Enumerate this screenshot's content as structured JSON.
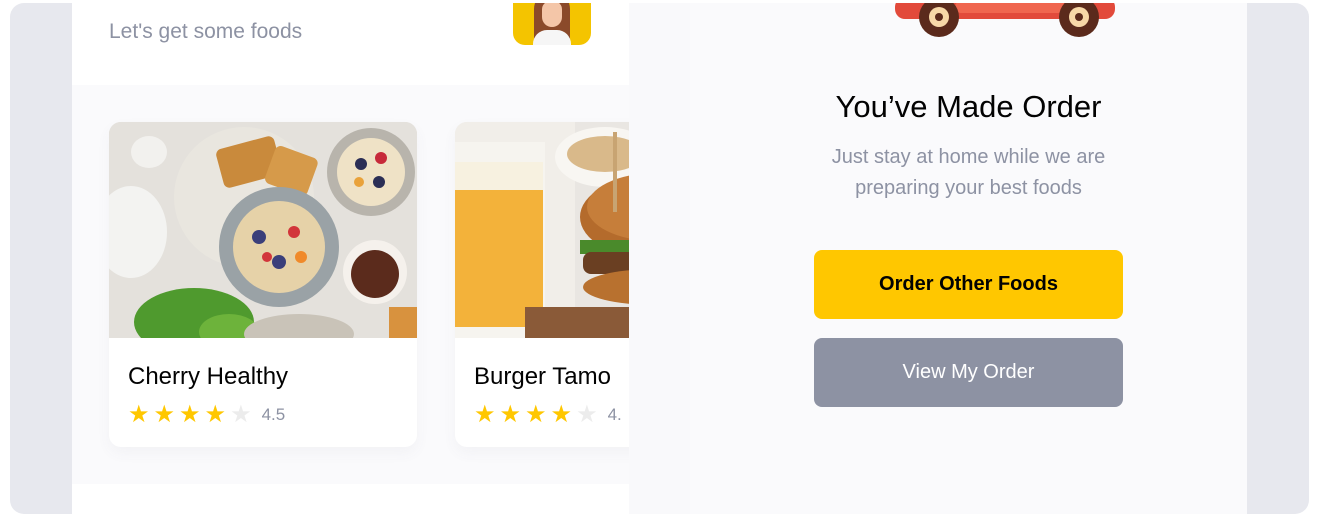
{
  "left_screen": {
    "subtitle": "Let's get some foods",
    "foods": [
      {
        "name": "Cherry Healthy",
        "rating": "4.5",
        "stars_filled": 4,
        "stars_total": 5
      },
      {
        "name": "Burger Tamo",
        "rating": "4.",
        "stars_filled": 4,
        "stars_total": 5
      }
    ]
  },
  "right_screen": {
    "title": "You’ve Made Order",
    "message": "Just stay at home while we are preparing your best foods",
    "primary_button": "Order Other Foods",
    "secondary_button": "View My Order"
  },
  "icons": {
    "avatar": "user-avatar-photo",
    "scooter": "delivery-scooter-illustration",
    "star_filled": "star-filled-icon",
    "star_empty": "star-empty-icon"
  },
  "colors": {
    "accent": "#ffc700",
    "secondary_button": "#8d92a3",
    "text_dark": "#020202",
    "text_muted": "#8d92a3",
    "frame_bg": "#e7e8ee"
  }
}
